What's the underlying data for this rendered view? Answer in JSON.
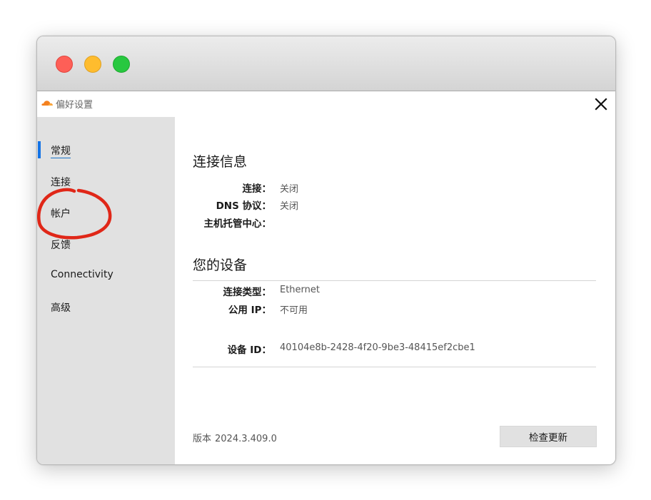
{
  "window": {
    "title": "偏好设置"
  },
  "sidebar": {
    "items": [
      {
        "label": "常规",
        "active": true
      },
      {
        "label": "连接"
      },
      {
        "label": "帐户"
      },
      {
        "label": "反馈"
      },
      {
        "label": "Connectivity"
      },
      {
        "label": "高级"
      }
    ]
  },
  "connection_info": {
    "title": "连接信息",
    "rows": [
      {
        "label": "连接：",
        "value": "关闭"
      },
      {
        "label": "DNS 协议：",
        "value": "关闭"
      },
      {
        "label": "主机托管中心：",
        "value": ""
      }
    ]
  },
  "device": {
    "title": "您的设备",
    "rows": [
      {
        "label": "连接类型：",
        "value": "Ethernet"
      },
      {
        "label": "公用 IP：",
        "value": "不可用"
      }
    ],
    "id_label": "设备 ID：",
    "id_value": "40104e8b-2428-4f20-9be3-48415ef2cbe1"
  },
  "footer": {
    "version_label": "版本",
    "version_value": "2024.3.409.0",
    "update_button": "检查更新"
  },
  "colors": {
    "accent": "#1473e6",
    "annotation": "#e02718",
    "sidebar_bg": "#e1e1e1",
    "logo_orange": "#f48120"
  },
  "icons": [
    "cloudflare-logo-icon",
    "close-icon"
  ]
}
